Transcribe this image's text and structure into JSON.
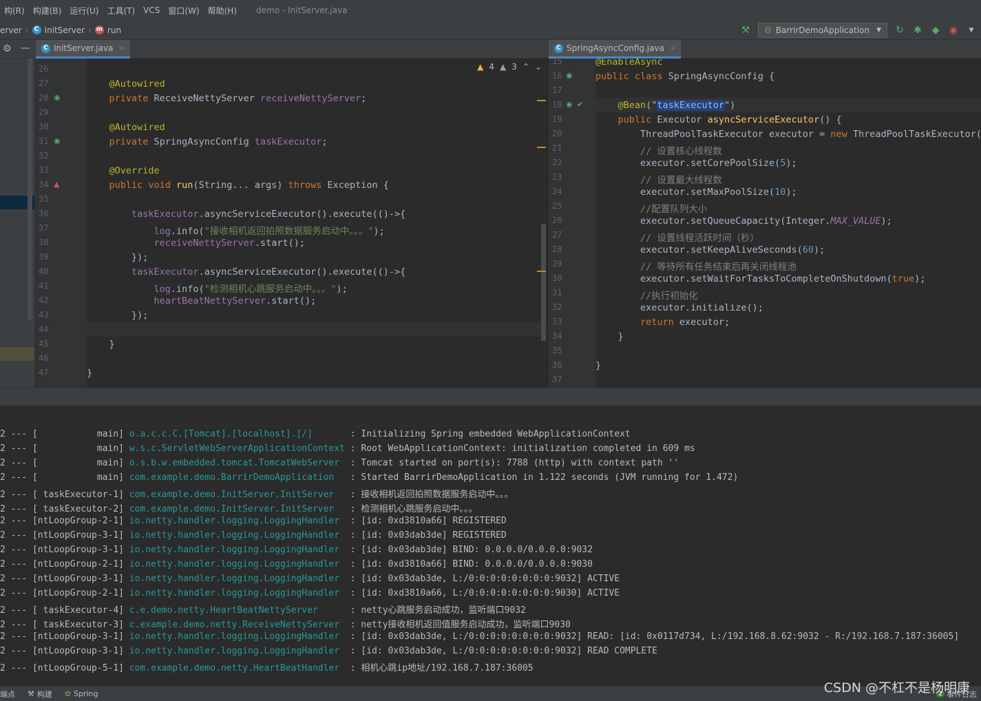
{
  "menu": {
    "items": [
      "构(R)",
      "构建(B)",
      "运行(U)",
      "工具(T)",
      "VCS",
      "窗口(W)",
      "帮助(H)"
    ],
    "window_title": "demo - InitServer.java"
  },
  "breadcrumb": {
    "items": [
      "erver",
      "InitServer",
      "run"
    ]
  },
  "toolbar": {
    "run_config": "BarrirDemoApplication",
    "icons": [
      "hammer-icon",
      "run-icon",
      "debug-icon",
      "coverage-icon",
      "profile-icon"
    ]
  },
  "tabs": {
    "left": {
      "label": "InitServer.java",
      "close": "×"
    },
    "right": {
      "label": "SpringAsyncConfig.java",
      "close": "×"
    }
  },
  "inspections": {
    "warnings": "4",
    "weak_warnings": "3"
  },
  "editor_left": {
    "line_numbers": [
      "26",
      "27",
      "28",
      "29",
      "30",
      "31",
      "32",
      "33",
      "34",
      "35",
      "36",
      "37",
      "38",
      "39",
      "40",
      "41",
      "42",
      "43",
      "44",
      "45",
      "46",
      "47"
    ],
    "lines": [
      [],
      [
        [
          "ann",
          "    @Autowired"
        ]
      ],
      [
        [
          "kw",
          "    private "
        ],
        [
          "",
          "ReceiveNettyServer "
        ],
        [
          "fld",
          "receiveNettyServer"
        ],
        [
          "",
          ";"
        ]
      ],
      [],
      [
        [
          "ann",
          "    @Autowired"
        ]
      ],
      [
        [
          "kw",
          "    private "
        ],
        [
          "",
          "SpringAsyncConfig "
        ],
        [
          "fld",
          "taskExecutor"
        ],
        [
          "",
          ";"
        ]
      ],
      [],
      [
        [
          "ann",
          "    @Override"
        ]
      ],
      [
        [
          "kw",
          "    public void "
        ],
        [
          "fn",
          "run"
        ],
        [
          "",
          "(String... args) "
        ],
        [
          "kw",
          "throws "
        ],
        [
          "",
          "Exception {"
        ]
      ],
      [],
      [
        [
          "fld",
          "        taskExecutor"
        ],
        [
          "",
          ".asyncServiceExecutor().execute(()->{"
        ]
      ],
      [
        [
          "fld",
          "            log"
        ],
        [
          "",
          ".info("
        ],
        [
          "str",
          "\"接收相机返回拍照数据服务启动中。。。\""
        ],
        [
          "",
          ");"
        ]
      ],
      [
        [
          "fld",
          "            receiveNettyServer"
        ],
        [
          "",
          ".start();"
        ]
      ],
      [
        [
          "",
          "        });"
        ]
      ],
      [
        [
          "fld",
          "        taskExecutor"
        ],
        [
          "",
          ".asyncServiceExecutor().execute(()->{"
        ]
      ],
      [
        [
          "fld",
          "            log"
        ],
        [
          "",
          ".info("
        ],
        [
          "str",
          "\"检测相机心跳服务启动中。。。\""
        ],
        [
          "",
          ");"
        ]
      ],
      [
        [
          "fld",
          "            heartBeatNettyServer"
        ],
        [
          "",
          ".start();"
        ]
      ],
      [
        [
          "",
          "        });"
        ]
      ],
      [],
      [
        [
          "",
          "    }"
        ]
      ],
      [],
      [
        [
          "",
          "}"
        ]
      ]
    ]
  },
  "editor_right": {
    "line_numbers": [
      "15",
      "16",
      "17",
      "18",
      "19",
      "20",
      "21",
      "22",
      "23",
      "24",
      "25",
      "26",
      "27",
      "28",
      "29",
      "30",
      "31",
      "32",
      "33",
      "34",
      "35",
      "36",
      "37"
    ],
    "lines": [
      [
        [
          "ann",
          "@EnableAsync"
        ]
      ],
      [
        [
          "kw",
          "public class "
        ],
        [
          "",
          "SpringAsyncConfig {"
        ]
      ],
      [],
      [
        [
          "ann",
          "    @Bean"
        ],
        [
          "",
          "(\""
        ],
        [
          "hl",
          "taskExecutor"
        ],
        [
          "",
          "\")"
        ]
      ],
      [
        [
          "kw",
          "    public "
        ],
        [
          "",
          "Executor "
        ],
        [
          "fn",
          "asyncServiceExecutor"
        ],
        [
          "",
          "() {"
        ]
      ],
      [
        [
          "",
          "        ThreadPoolTaskExecutor executor = "
        ],
        [
          "kw",
          "new "
        ],
        [
          "",
          "ThreadPoolTaskExecutor();"
        ]
      ],
      [
        [
          "cm",
          "        // 设置核心线程数"
        ]
      ],
      [
        [
          "",
          "        executor.setCorePoolSize("
        ],
        [
          "num",
          "5"
        ],
        [
          "",
          ");"
        ]
      ],
      [
        [
          "cm",
          "        // 设置最大线程数"
        ]
      ],
      [
        [
          "",
          "        executor.setMaxPoolSize("
        ],
        [
          "num",
          "10"
        ],
        [
          "",
          ");"
        ]
      ],
      [
        [
          "cm",
          "        //配置队列大小"
        ]
      ],
      [
        [
          "",
          "        executor.setQueueCapacity(Integer."
        ],
        [
          "fld it",
          "MAX_VALUE"
        ],
        [
          "",
          ");"
        ]
      ],
      [
        [
          "cm",
          "        // 设置线程活跃时间（秒）"
        ]
      ],
      [
        [
          "",
          "        executor.setKeepAliveSeconds("
        ],
        [
          "num",
          "60"
        ],
        [
          "",
          ");"
        ]
      ],
      [
        [
          "cm",
          "        // 等待所有任务结束后再关闭线程池"
        ]
      ],
      [
        [
          "",
          "        executor.setWaitForTasksToCompleteOnShutdown("
        ],
        [
          "kw",
          "true"
        ],
        [
          "",
          ");"
        ]
      ],
      [
        [
          "cm",
          "        //执行初始化"
        ]
      ],
      [
        [
          "",
          "        executor.initialize();"
        ]
      ],
      [
        [
          "kw",
          "        return "
        ],
        [
          "",
          "executor;"
        ]
      ],
      [
        [
          "",
          "    }"
        ]
      ],
      [],
      [
        [
          "",
          "}"
        ]
      ],
      []
    ]
  },
  "console": {
    "lines": [
      [
        "2 --- [           main] ",
        "o.a.c.c.C.[Tomcat].[localhost].[/]      ",
        " : Initializing Spring embedded WebApplicationContext"
      ],
      [
        "2 --- [           main] ",
        "w.s.c.ServletWebServerApplicationContext",
        " : Root WebApplicationContext: initialization completed in 609 ms"
      ],
      [
        "2 --- [           main] ",
        "o.s.b.w.embedded.tomcat.TomcatWebServer ",
        " : Tomcat started on port(s): 7788 (http) with context path ''"
      ],
      [
        "2 --- [           main] ",
        "com.example.demo.BarrirDemoApplication  ",
        " : Started BarrirDemoApplication in 1.122 seconds (JVM running for 1.472)"
      ],
      [
        "2 --- [ taskExecutor-1] ",
        "com.example.demo.InitServer.InitServer  ",
        " : 接收相机返回拍照数据服务启动中。。。"
      ],
      [
        "2 --- [ taskExecutor-2] ",
        "com.example.demo.InitServer.InitServer  ",
        " : 检测相机心跳服务启动中。。。"
      ],
      [
        "2 --- [ntLoopGroup-2-1] ",
        "io.netty.handler.logging.LoggingHandler ",
        " : [id: 0xd3810a66] REGISTERED"
      ],
      [
        "2 --- [ntLoopGroup-3-1] ",
        "io.netty.handler.logging.LoggingHandler ",
        " : [id: 0x03dab3de] REGISTERED"
      ],
      [
        "2 --- [ntLoopGroup-3-1] ",
        "io.netty.handler.logging.LoggingHandler ",
        " : [id: 0x03dab3de] BIND: 0.0.0.0/0.0.0.0:9032"
      ],
      [
        "2 --- [ntLoopGroup-2-1] ",
        "io.netty.handler.logging.LoggingHandler ",
        " : [id: 0xd3810a66] BIND: 0.0.0.0/0.0.0.0:9030"
      ],
      [
        "2 --- [ntLoopGroup-3-1] ",
        "io.netty.handler.logging.LoggingHandler ",
        " : [id: 0x03dab3de, L:/0:0:0:0:0:0:0:0:9032] ACTIVE"
      ],
      [
        "2 --- [ntLoopGroup-2-1] ",
        "io.netty.handler.logging.LoggingHandler ",
        " : [id: 0xd3810a66, L:/0:0:0:0:0:0:0:0:9030] ACTIVE"
      ],
      [
        "2 --- [ taskExecutor-4] ",
        "c.e.demo.netty.HeartBeatNettyServer     ",
        " : netty心跳服务启动成功，监听端口9032"
      ],
      [
        "2 --- [ taskExecutor-3] ",
        "c.example.demo.netty.ReceiveNettyServer ",
        " : netty接收相机返回值服务启动成功，监听端口9030"
      ],
      [
        "2 --- [ntLoopGroup-3-1] ",
        "io.netty.handler.logging.LoggingHandler ",
        " : [id: 0x03dab3de, L:/0:0:0:0:0:0:0:0:9032] READ: [id: 0x0117d734, L:/192.168.8.62:9032 - R:/192.168.7.187:36005]"
      ],
      [
        "2 --- [ntLoopGroup-3-1] ",
        "io.netty.handler.logging.LoggingHandler ",
        " : [id: 0x03dab3de, L:/0:0:0:0:0:0:0:0:9032] READ COMPLETE"
      ],
      [
        "2 --- [ntLoopGroup-5-1] ",
        "com.example.demo.netty.HeartBeatHandler ",
        " : 相机心跳ip地址/192.168.7.187:36005"
      ]
    ]
  },
  "statusbar": {
    "items": [
      "端点",
      "构建",
      "Spring"
    ],
    "event_log": "事件日志"
  },
  "watermark": "CSDN @不杠不是杨明康",
  "colors": {
    "accent": "#4a88c7",
    "logger": "#299999"
  }
}
